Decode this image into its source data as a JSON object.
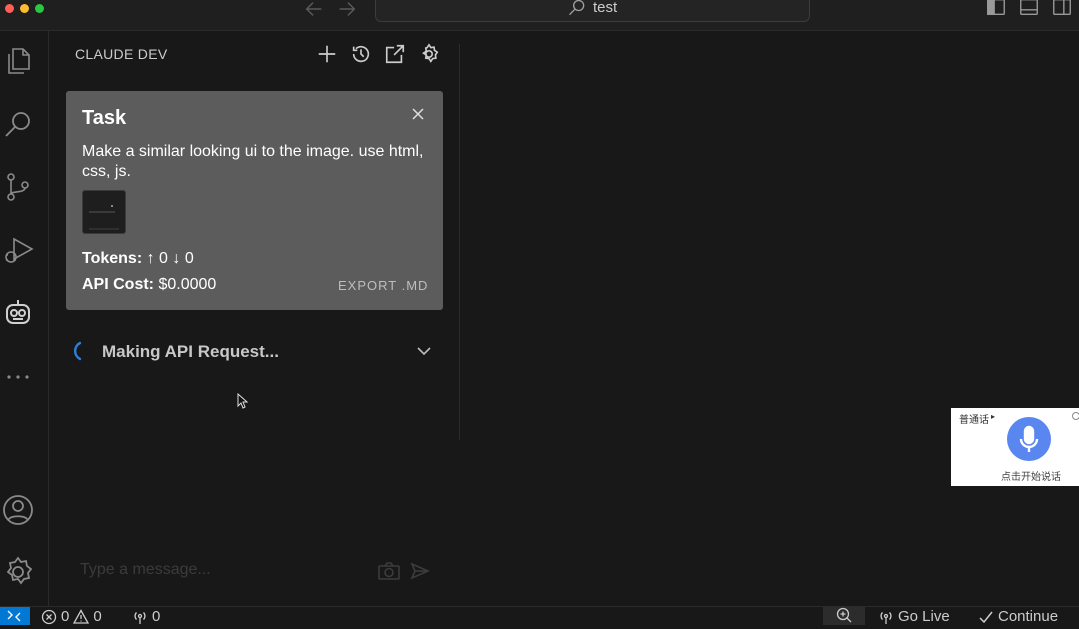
{
  "titlebar": {
    "search_text": "test"
  },
  "sidebar": {
    "title": "CLAUDE DEV",
    "actions": [
      {
        "icon": "plus-icon",
        "label": "New Task"
      },
      {
        "icon": "history-icon",
        "label": "History"
      },
      {
        "icon": "open-in-editor-icon",
        "label": "Open in Editor"
      },
      {
        "icon": "settings-icon",
        "label": "Settings"
      }
    ]
  },
  "task": {
    "title": "Task",
    "description": "Make a similar looking ui to the image. use html, css, js.",
    "tokens_label": "Tokens:",
    "tokens_up": "↑ 0",
    "tokens_down": "↓ 0",
    "cost_label": "API Cost:",
    "cost_value": "$0.0000",
    "export_label": "EXPORT .MD"
  },
  "request": {
    "label": "Making API Request..."
  },
  "composer": {
    "placeholder": "Type a message..."
  },
  "voice_widget": {
    "label": "普通话",
    "caption": "点击开始说话",
    "accent": "#5a86f0"
  },
  "statusbar": {
    "errors": "0",
    "warnings": "0",
    "ports": "0",
    "go_live": "Go Live",
    "continue": "Continue",
    "accent": "#0078d4"
  }
}
